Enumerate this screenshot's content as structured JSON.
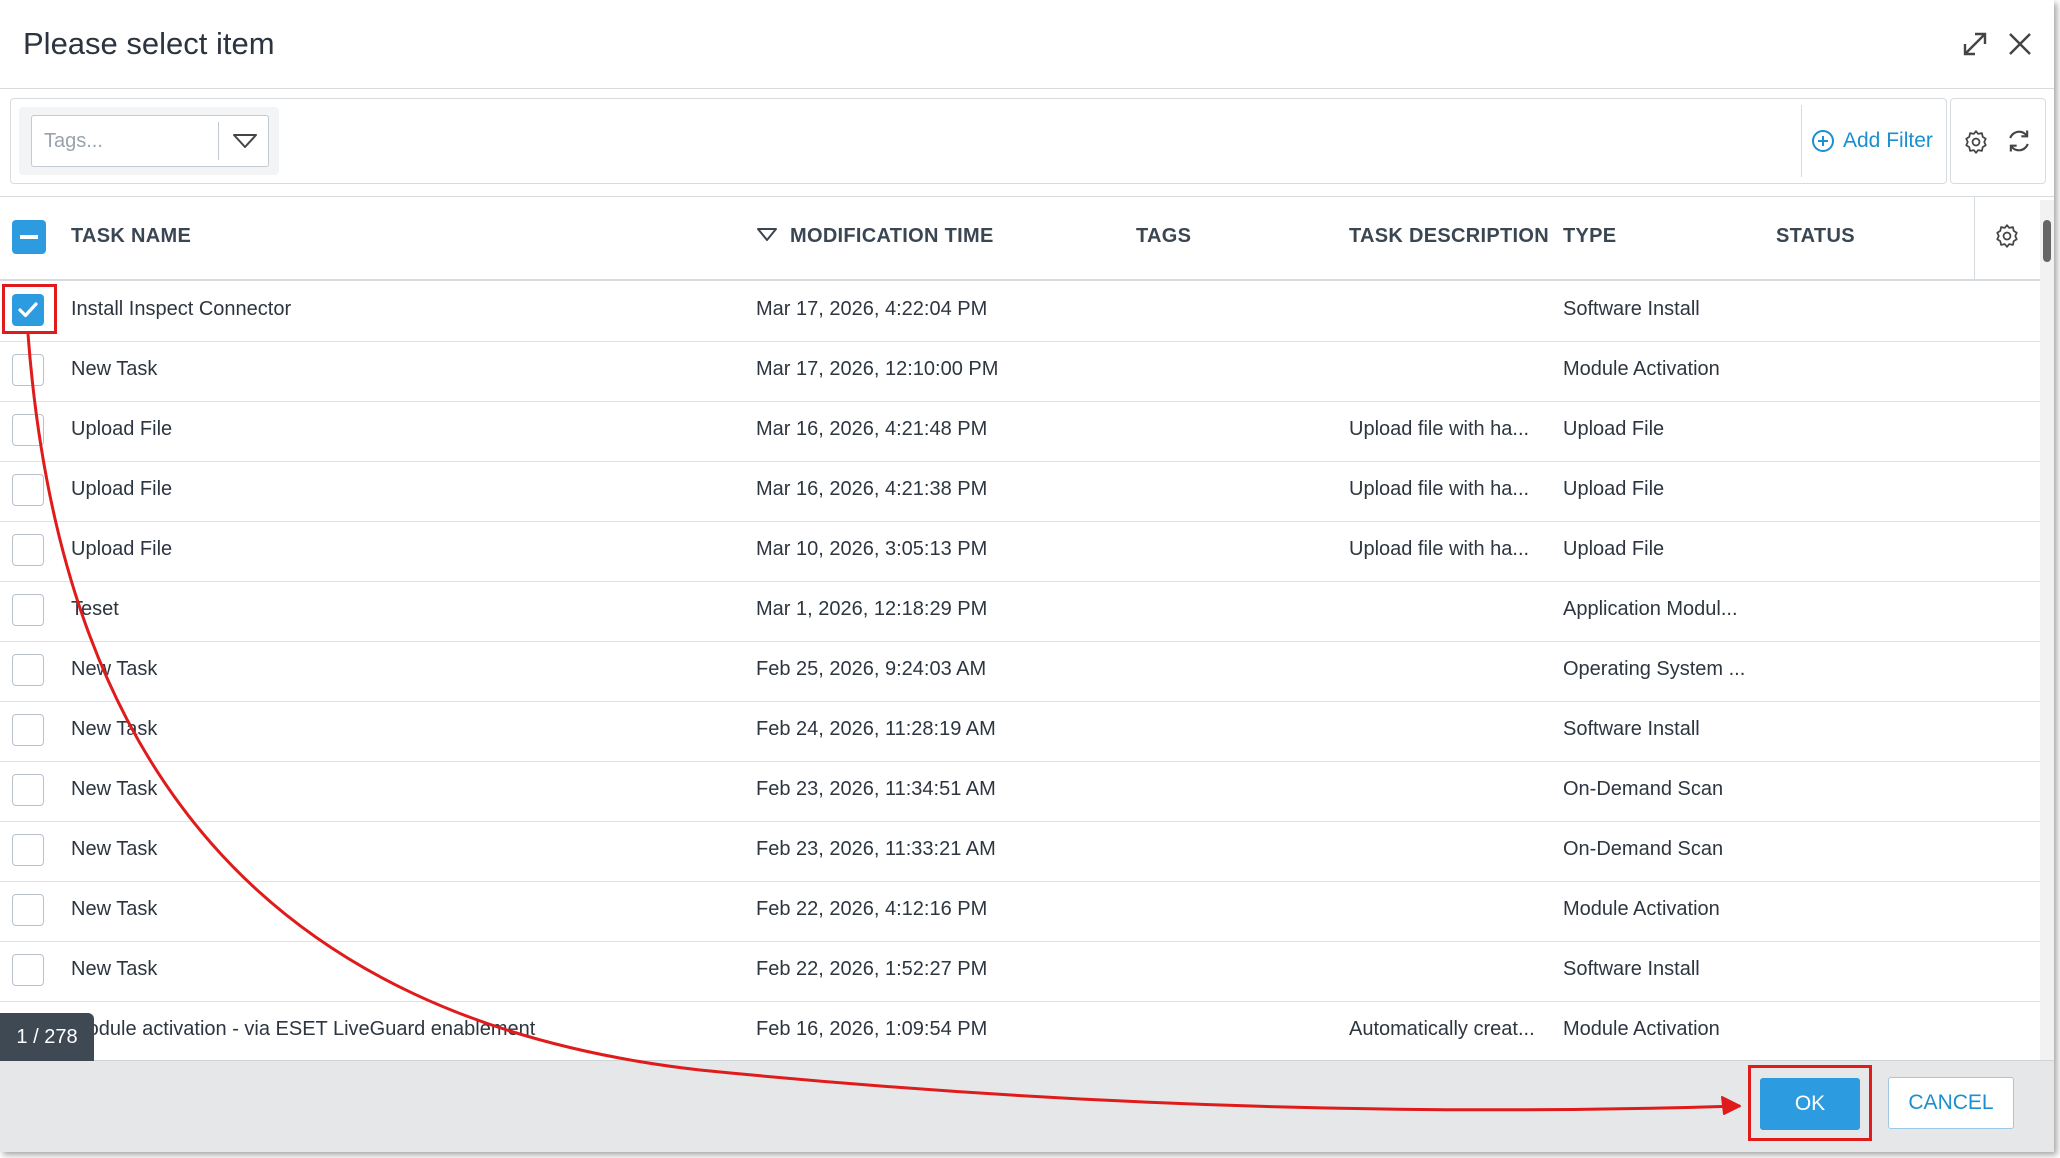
{
  "dialog": {
    "title": "Please select item"
  },
  "toolbar": {
    "tags_placeholder": "Tags...",
    "add_filter_label": "Add Filter"
  },
  "columns": {
    "task_name": "TASK NAME",
    "modification_time": "MODIFICATION TIME",
    "tags": "TAGS",
    "task_description": "TASK DESCRIPTION",
    "type": "TYPE",
    "status": "STATUS"
  },
  "rows": [
    {
      "name": "Install Inspect Connector",
      "time": "Mar 17, 2026, 4:22:04 PM",
      "description": "",
      "type": "Software Install",
      "checked": true
    },
    {
      "name": "New Task",
      "time": "Mar 17, 2026, 12:10:00 PM",
      "description": "",
      "type": "Module Activation",
      "checked": false
    },
    {
      "name": "Upload File",
      "time": "Mar 16, 2026, 4:21:48 PM",
      "description": "Upload file with ha...",
      "type": "Upload File",
      "checked": false
    },
    {
      "name": "Upload File",
      "time": "Mar 16, 2026, 4:21:38 PM",
      "description": "Upload file with ha...",
      "type": "Upload File",
      "checked": false
    },
    {
      "name": "Upload File",
      "time": "Mar 10, 2026, 3:05:13 PM",
      "description": "Upload file with ha...",
      "type": "Upload File",
      "checked": false
    },
    {
      "name": "Teset",
      "time": "Mar 1, 2026, 12:18:29 PM",
      "description": "",
      "type": "Application Modul...",
      "checked": false
    },
    {
      "name": "New Task",
      "time": "Feb 25, 2026, 9:24:03 AM",
      "description": "",
      "type": "Operating System ...",
      "checked": false
    },
    {
      "name": "New Task",
      "time": "Feb 24, 2026, 11:28:19 AM",
      "description": "",
      "type": "Software Install",
      "checked": false
    },
    {
      "name": "New Task",
      "time": "Feb 23, 2026, 11:34:51 AM",
      "description": "",
      "type": "On-Demand Scan",
      "checked": false
    },
    {
      "name": "New Task",
      "time": "Feb 23, 2026, 11:33:21 AM",
      "description": "",
      "type": "On-Demand Scan",
      "checked": false
    },
    {
      "name": "New Task",
      "time": "Feb 22, 2026, 4:12:16 PM",
      "description": "",
      "type": "Module Activation",
      "checked": false
    },
    {
      "name": "New Task",
      "time": "Feb 22, 2026, 1:52:27 PM",
      "description": "",
      "type": "Software Install",
      "checked": false
    },
    {
      "name": "Module activation - via ESET LiveGuard enablement",
      "time": "Feb 16, 2026, 1:09:54 PM",
      "description": "Automatically creat...",
      "type": "Module Activation",
      "checked": false
    }
  ],
  "pagination": {
    "counter": "1 / 278"
  },
  "footer": {
    "ok_label": "OK",
    "cancel_label": "CANCEL"
  },
  "icons": {
    "expand": "expand-icon",
    "close": "close-icon",
    "caret": "caret-down-icon",
    "add": "plus-circle-icon",
    "gear": "gear-icon",
    "refresh": "refresh-icon",
    "sort": "sort-desc-icon",
    "check": "check-icon"
  },
  "colors": {
    "accent": "#2d9be0",
    "link": "#1b8fd0",
    "annotation": "#e01b1b"
  }
}
